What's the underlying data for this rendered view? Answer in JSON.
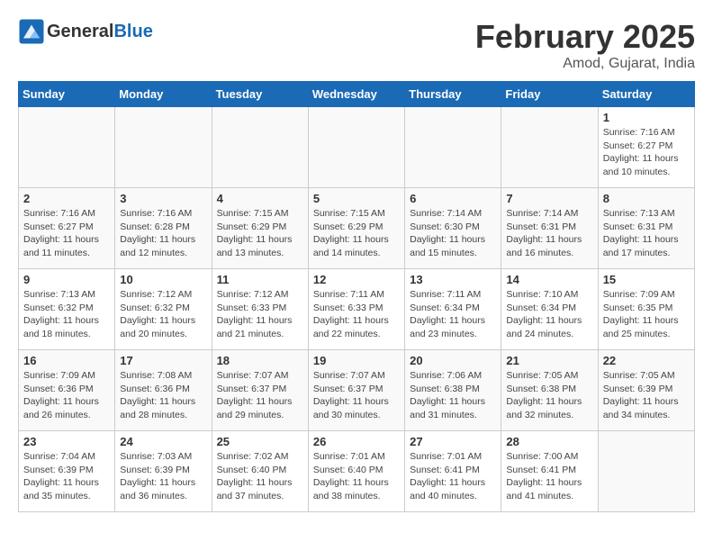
{
  "header": {
    "logo_line1": "General",
    "logo_line2": "Blue",
    "month_title": "February 2025",
    "location": "Amod, Gujarat, India"
  },
  "weekdays": [
    "Sunday",
    "Monday",
    "Tuesday",
    "Wednesday",
    "Thursday",
    "Friday",
    "Saturday"
  ],
  "weeks": [
    [
      {
        "day": "",
        "info": ""
      },
      {
        "day": "",
        "info": ""
      },
      {
        "day": "",
        "info": ""
      },
      {
        "day": "",
        "info": ""
      },
      {
        "day": "",
        "info": ""
      },
      {
        "day": "",
        "info": ""
      },
      {
        "day": "1",
        "info": "Sunrise: 7:16 AM\nSunset: 6:27 PM\nDaylight: 11 hours\nand 10 minutes."
      }
    ],
    [
      {
        "day": "2",
        "info": "Sunrise: 7:16 AM\nSunset: 6:27 PM\nDaylight: 11 hours\nand 11 minutes."
      },
      {
        "day": "3",
        "info": "Sunrise: 7:16 AM\nSunset: 6:28 PM\nDaylight: 11 hours\nand 12 minutes."
      },
      {
        "day": "4",
        "info": "Sunrise: 7:15 AM\nSunset: 6:29 PM\nDaylight: 11 hours\nand 13 minutes."
      },
      {
        "day": "5",
        "info": "Sunrise: 7:15 AM\nSunset: 6:29 PM\nDaylight: 11 hours\nand 14 minutes."
      },
      {
        "day": "6",
        "info": "Sunrise: 7:14 AM\nSunset: 6:30 PM\nDaylight: 11 hours\nand 15 minutes."
      },
      {
        "day": "7",
        "info": "Sunrise: 7:14 AM\nSunset: 6:31 PM\nDaylight: 11 hours\nand 16 minutes."
      },
      {
        "day": "8",
        "info": "Sunrise: 7:13 AM\nSunset: 6:31 PM\nDaylight: 11 hours\nand 17 minutes."
      }
    ],
    [
      {
        "day": "9",
        "info": "Sunrise: 7:13 AM\nSunset: 6:32 PM\nDaylight: 11 hours\nand 18 minutes."
      },
      {
        "day": "10",
        "info": "Sunrise: 7:12 AM\nSunset: 6:32 PM\nDaylight: 11 hours\nand 20 minutes."
      },
      {
        "day": "11",
        "info": "Sunrise: 7:12 AM\nSunset: 6:33 PM\nDaylight: 11 hours\nand 21 minutes."
      },
      {
        "day": "12",
        "info": "Sunrise: 7:11 AM\nSunset: 6:33 PM\nDaylight: 11 hours\nand 22 minutes."
      },
      {
        "day": "13",
        "info": "Sunrise: 7:11 AM\nSunset: 6:34 PM\nDaylight: 11 hours\nand 23 minutes."
      },
      {
        "day": "14",
        "info": "Sunrise: 7:10 AM\nSunset: 6:34 PM\nDaylight: 11 hours\nand 24 minutes."
      },
      {
        "day": "15",
        "info": "Sunrise: 7:09 AM\nSunset: 6:35 PM\nDaylight: 11 hours\nand 25 minutes."
      }
    ],
    [
      {
        "day": "16",
        "info": "Sunrise: 7:09 AM\nSunset: 6:36 PM\nDaylight: 11 hours\nand 26 minutes."
      },
      {
        "day": "17",
        "info": "Sunrise: 7:08 AM\nSunset: 6:36 PM\nDaylight: 11 hours\nand 28 minutes."
      },
      {
        "day": "18",
        "info": "Sunrise: 7:07 AM\nSunset: 6:37 PM\nDaylight: 11 hours\nand 29 minutes."
      },
      {
        "day": "19",
        "info": "Sunrise: 7:07 AM\nSunset: 6:37 PM\nDaylight: 11 hours\nand 30 minutes."
      },
      {
        "day": "20",
        "info": "Sunrise: 7:06 AM\nSunset: 6:38 PM\nDaylight: 11 hours\nand 31 minutes."
      },
      {
        "day": "21",
        "info": "Sunrise: 7:05 AM\nSunset: 6:38 PM\nDaylight: 11 hours\nand 32 minutes."
      },
      {
        "day": "22",
        "info": "Sunrise: 7:05 AM\nSunset: 6:39 PM\nDaylight: 11 hours\nand 34 minutes."
      }
    ],
    [
      {
        "day": "23",
        "info": "Sunrise: 7:04 AM\nSunset: 6:39 PM\nDaylight: 11 hours\nand 35 minutes."
      },
      {
        "day": "24",
        "info": "Sunrise: 7:03 AM\nSunset: 6:39 PM\nDaylight: 11 hours\nand 36 minutes."
      },
      {
        "day": "25",
        "info": "Sunrise: 7:02 AM\nSunset: 6:40 PM\nDaylight: 11 hours\nand 37 minutes."
      },
      {
        "day": "26",
        "info": "Sunrise: 7:01 AM\nSunset: 6:40 PM\nDaylight: 11 hours\nand 38 minutes."
      },
      {
        "day": "27",
        "info": "Sunrise: 7:01 AM\nSunset: 6:41 PM\nDaylight: 11 hours\nand 40 minutes."
      },
      {
        "day": "28",
        "info": "Sunrise: 7:00 AM\nSunset: 6:41 PM\nDaylight: 11 hours\nand 41 minutes."
      },
      {
        "day": "",
        "info": ""
      }
    ]
  ]
}
